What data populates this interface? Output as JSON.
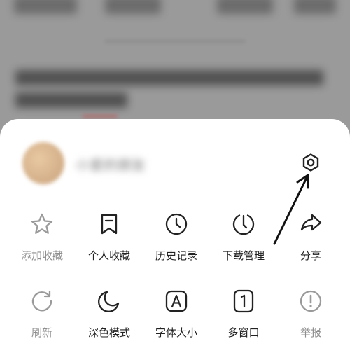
{
  "user": {
    "name": "小爱的朋友"
  },
  "menu": {
    "row1": [
      {
        "label": "添加收藏",
        "icon": "star-icon",
        "muted": true
      },
      {
        "label": "个人收藏",
        "icon": "bookmark-icon",
        "muted": false
      },
      {
        "label": "历史记录",
        "icon": "clock-icon",
        "muted": false
      },
      {
        "label": "下载管理",
        "icon": "download-clock-icon",
        "muted": false
      },
      {
        "label": "分享",
        "icon": "share-icon",
        "muted": false
      }
    ],
    "row2": [
      {
        "label": "刷新",
        "icon": "refresh-icon",
        "muted": true
      },
      {
        "label": "深色模式",
        "icon": "moon-icon",
        "muted": false
      },
      {
        "label": "字体大小",
        "icon": "font-size-icon",
        "muted": false
      },
      {
        "label": "多窗口",
        "icon": "multi-window-icon",
        "muted": false
      },
      {
        "label": "举报",
        "icon": "report-icon",
        "muted": true
      }
    ]
  },
  "colors": {
    "icon_dark": "#222222",
    "icon_muted": "#9a9a9a",
    "sheet_bg": "#ffffff",
    "overlay": "#8e8e8e"
  }
}
